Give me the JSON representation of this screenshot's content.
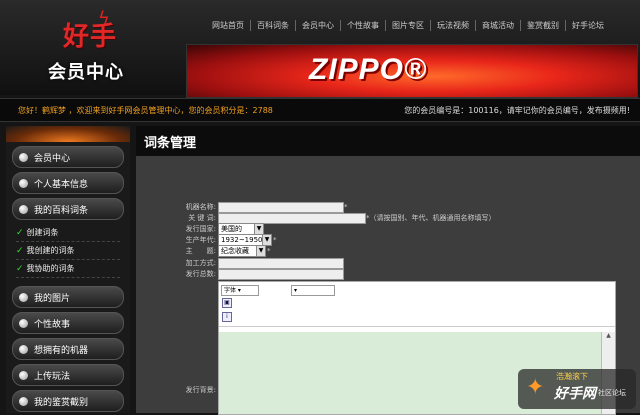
{
  "header": {
    "logo_main": "好手",
    "logo_sub": "会员中心",
    "nav": [
      "网站首页",
      "百科词条",
      "会员中心",
      "个性故事",
      "图片专区",
      "玩法视频",
      "商城活动",
      "鉴赏截别",
      "好手论坛"
    ],
    "banner_brand": "ZIPPO®"
  },
  "infobar": {
    "welcome": "您好！鹤辉梦 ，欢迎来到好手网会员管理中心，您的会员积分是：2788",
    "member_info": "您的会员编号是：100116，请牢记你的会员编号，发布摄频用!"
  },
  "sidebar": {
    "items": [
      {
        "label": "会员中心",
        "type": "button"
      },
      {
        "label": "个人基本信息",
        "type": "button"
      },
      {
        "label": "我的百科词条",
        "type": "button"
      },
      {
        "label": "创建词条",
        "type": "sub"
      },
      {
        "label": "我创建的词条",
        "type": "sub"
      },
      {
        "label": "我协助的词条",
        "type": "sub"
      },
      {
        "label": "我的图片",
        "type": "button"
      },
      {
        "label": "个性故事",
        "type": "button"
      },
      {
        "label": "想拥有的机器",
        "type": "button"
      },
      {
        "label": "上传玩法",
        "type": "button"
      },
      {
        "label": "我的鉴赏截别",
        "type": "button"
      }
    ]
  },
  "main": {
    "title": "词条管理",
    "fields": {
      "model_label": "机器名称:",
      "model_value": "",
      "keyword_label": "关 键 词:",
      "keyword_value": "",
      "keyword_hint": "*（请按国别、年代、机器通用名称填写）",
      "country_label": "发行国家:",
      "country_value": "美国的",
      "era_label": "生产年代:",
      "era_value": "1932~1950",
      "subject_label": "主　　题:",
      "subject_value": "纪念收藏",
      "process_label": "加工方式:",
      "process_value": "",
      "total_label": "发行总数:",
      "total_value": "",
      "background_label": "发行背景:"
    },
    "editor": {
      "font_select": "字体",
      "size_select": ""
    }
  },
  "watermark": {
    "line1": "浩瀚滚下",
    "brand": "好手网",
    "suffix": "社区论坛"
  }
}
